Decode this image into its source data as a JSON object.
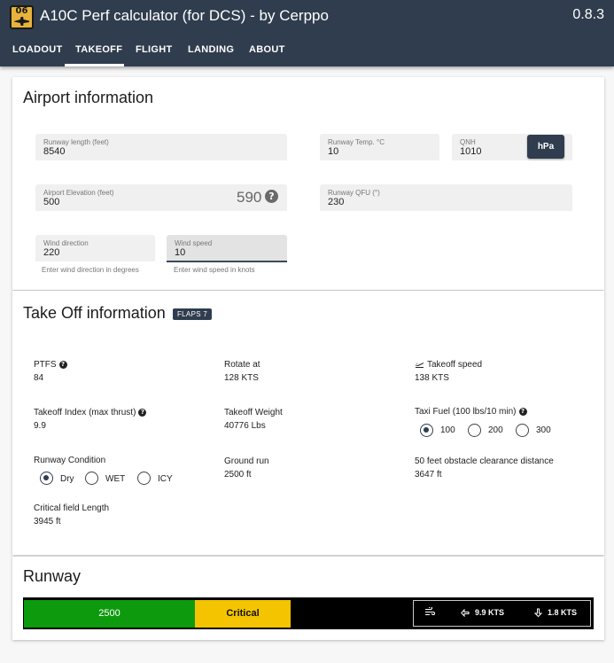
{
  "app": {
    "logo_text": "06",
    "title": "A10C Perf calculator (for DCS) - by Cerppo",
    "version": "0.8.3",
    "tabs": [
      {
        "label": "LOADOUT",
        "active": false
      },
      {
        "label": "TAKEOFF",
        "active": true
      },
      {
        "label": "FLIGHT",
        "active": false
      },
      {
        "label": "LANDING",
        "active": false
      },
      {
        "label": "ABOUT",
        "active": false
      }
    ]
  },
  "airport": {
    "heading": "Airport information",
    "runway_length": {
      "label": "Runway length (feet)",
      "value": "8540"
    },
    "runway_temp": {
      "label": "Runway Temp. °C",
      "value": "10"
    },
    "qnh": {
      "label": "QNH",
      "value": "1010",
      "unit_button": "hPa"
    },
    "elevation": {
      "label": "Airport Elevation (feet)",
      "value": "500",
      "converted": "590"
    },
    "runway_qfu": {
      "label": "Runway QFU (°)",
      "value": "230"
    },
    "wind_direction": {
      "label": "Wind direction",
      "value": "220",
      "helper": "Enter wind direction in degrees"
    },
    "wind_speed": {
      "label": "Wind speed",
      "value": "10",
      "helper": "Enter wind speed in knots"
    }
  },
  "takeoff": {
    "heading": "Take Off information",
    "flaps_badge": "FLAPS 7",
    "ptfs": {
      "label": "PTFS",
      "value": "84"
    },
    "rotate": {
      "label": "Rotate at",
      "value": "128 KTS"
    },
    "takeoff_speed": {
      "label": "Takeoff speed",
      "value": "138 KTS"
    },
    "takeoff_index": {
      "label": "Takeoff Index (max thrust)",
      "value": "9.9"
    },
    "takeoff_weight": {
      "label": "Takeoff Weight",
      "value": "40776 Lbs"
    },
    "taxi_fuel": {
      "label": "Taxi Fuel (100 lbs/10 min)",
      "options": [
        "100",
        "200",
        "300"
      ],
      "selected": "100"
    },
    "runway_condition": {
      "label": "Runway Condition",
      "options": [
        "Dry",
        "WET",
        "ICY"
      ],
      "selected": "Dry"
    },
    "ground_run": {
      "label": "Ground run",
      "value": "2500 ft"
    },
    "obstacle": {
      "label": "50 feet obstacle clearance distance",
      "value": "3647 ft"
    },
    "critical_field": {
      "label": "Critical field Length",
      "value": "3945 ft"
    }
  },
  "runway": {
    "heading": "Runway",
    "ground_run_label": "2500",
    "critical_label": "Critical",
    "headwind": "9.9 KTS",
    "crosswind": "1.8 KTS",
    "colors": {
      "ground_run": "#0d9a0d",
      "critical": "#f4c400",
      "remaining": "#000000"
    }
  }
}
